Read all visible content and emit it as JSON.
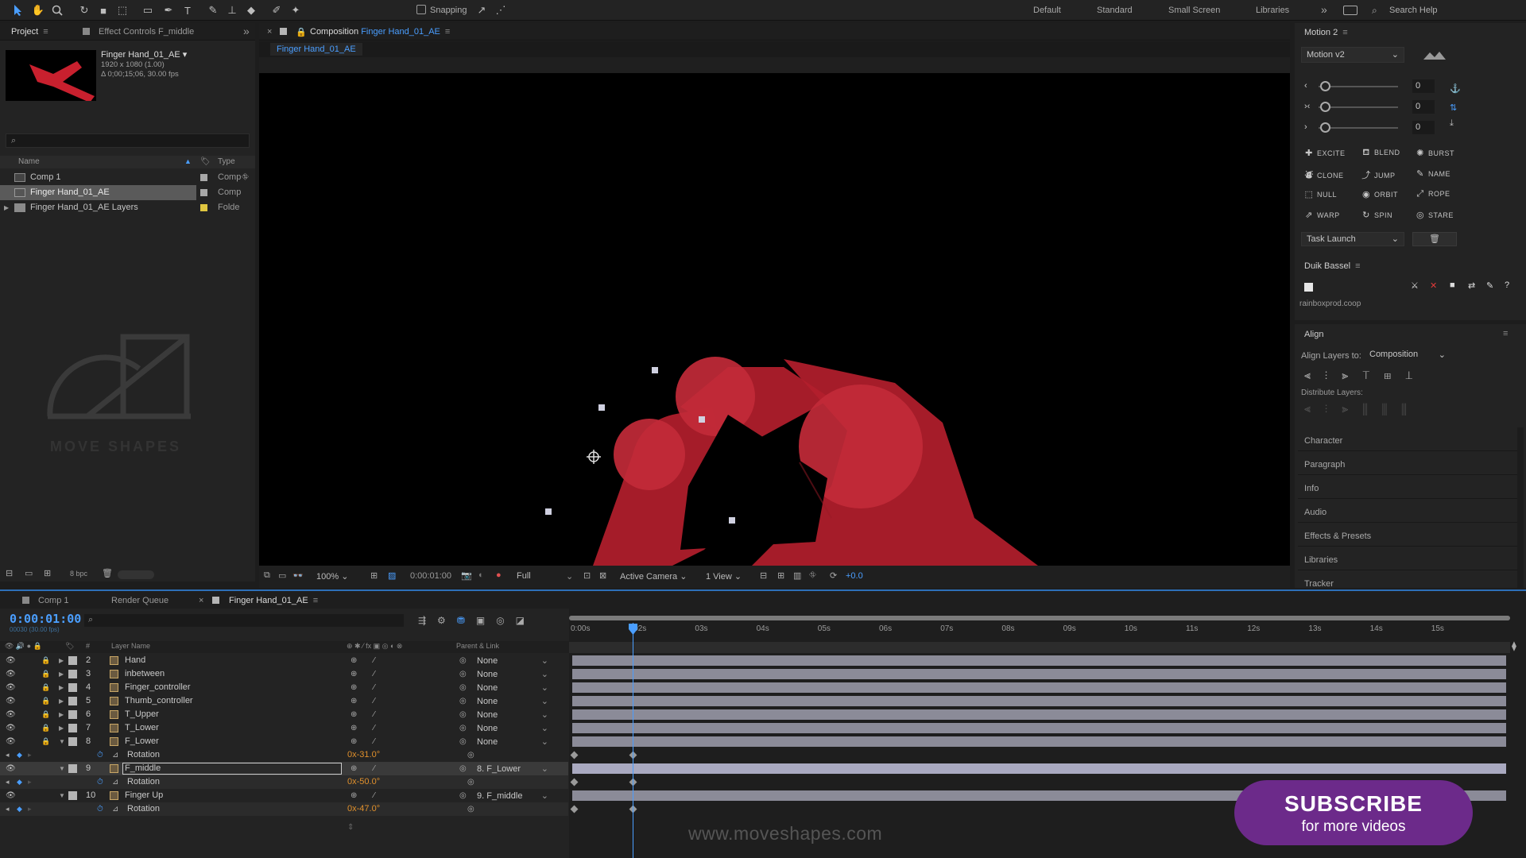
{
  "toolbar": {
    "snapping_label": "Snapping",
    "workspaces": [
      "Default",
      "Standard",
      "Small Screen",
      "Libraries"
    ],
    "search_placeholder": "Search Help"
  },
  "project_panel": {
    "tabs": [
      "Project",
      "Effect Controls F_middle"
    ],
    "selected_item": {
      "name": "Finger Hand_01_AE",
      "resolution": "1920 x 1080 (1.00)",
      "duration": "Δ 0;00;15;06, 30.00 fps"
    },
    "columns": {
      "name": "Name",
      "type": "Type"
    },
    "items": [
      {
        "name": "Comp 1",
        "type": "Comp"
      },
      {
        "name": "Finger Hand_01_AE",
        "type": "Comp"
      },
      {
        "name": "Finger Hand_01_AE Layers",
        "type": "Folde"
      }
    ],
    "logo_text": "MOVE SHAPES",
    "bpc": "8 bpc"
  },
  "composition": {
    "tab_prefix": "Composition",
    "tab_name": "Finger Hand_01_AE",
    "subtab": "Finger Hand_01_AE",
    "footer": {
      "zoom": "100%",
      "time": "0:00:01:00",
      "resolution": "Full",
      "camera": "Active Camera",
      "views": "1 View",
      "exposure": "+0.0"
    }
  },
  "motion_panel": {
    "title": "Motion 2",
    "dropdown": "Motion v2",
    "slider_values": [
      "0",
      "0",
      "0"
    ],
    "buttons": [
      [
        "EXCITE",
        "BLEND",
        "BURST"
      ],
      [
        "CLONE",
        "JUMP",
        "NAME"
      ],
      [
        "NULL",
        "ORBIT",
        "ROPE"
      ],
      [
        "WARP",
        "SPIN",
        "STARE"
      ]
    ],
    "task_dropdown": "Task Launch"
  },
  "duik_panel": {
    "title": "Duik Bassel",
    "link": "rainboxprod.coop"
  },
  "align_panel": {
    "title": "Align",
    "align_to_label": "Align Layers to:",
    "align_to_value": "Composition",
    "distribute_label": "Distribute Layers:"
  },
  "right_sections": [
    "Character",
    "Paragraph",
    "Info",
    "Audio",
    "Effects & Presets",
    "Libraries",
    "Tracker"
  ],
  "timeline": {
    "tabs": [
      "Comp 1",
      "Render Queue",
      "Finger Hand_01_AE"
    ],
    "current_time": "0:00:01:00",
    "frame_info": "00030 (30.00 fps)",
    "col_num": "#",
    "col_layer_name": "Layer Name",
    "col_parent": "Parent & Link",
    "ruler_labels": [
      "0:00s",
      "02s",
      "03s",
      "04s",
      "05s",
      "06s",
      "07s",
      "08s",
      "09s",
      "10s",
      "11s",
      "12s",
      "13s",
      "14s",
      "15s"
    ],
    "layers": [
      {
        "num": "2",
        "name": "Hand",
        "parent": "None"
      },
      {
        "num": "3",
        "name": "inbetween",
        "parent": "None"
      },
      {
        "num": "4",
        "name": "Finger_controller",
        "parent": "None"
      },
      {
        "num": "5",
        "name": "Thumb_controller",
        "parent": "None"
      },
      {
        "num": "6",
        "name": "T_Upper",
        "parent": "None"
      },
      {
        "num": "7",
        "name": "T_Lower",
        "parent": "None"
      },
      {
        "num": "8",
        "name": "F_Lower",
        "parent": "None"
      },
      {
        "num": "",
        "name": "Rotation",
        "value": "0x-31.0°",
        "prop": true
      },
      {
        "num": "9",
        "name": "F_middle",
        "parent": "8. F_Lower",
        "selected": true
      },
      {
        "num": "",
        "name": "Rotation",
        "value": "0x-50.0°",
        "prop": true
      },
      {
        "num": "10",
        "name": "Finger Up",
        "parent": "9. F_middle"
      },
      {
        "num": "",
        "name": "Rotation",
        "value": "0x-47.0°",
        "prop": true
      }
    ],
    "watermark": "www.moveshapes.com"
  },
  "subscribe": {
    "line1": "SUBSCRIBE",
    "line2": "for more videos",
    "color": "#6c2a8a"
  },
  "colors": {
    "accent": "#2d8ceb",
    "shape_red": "#b31e2c"
  }
}
